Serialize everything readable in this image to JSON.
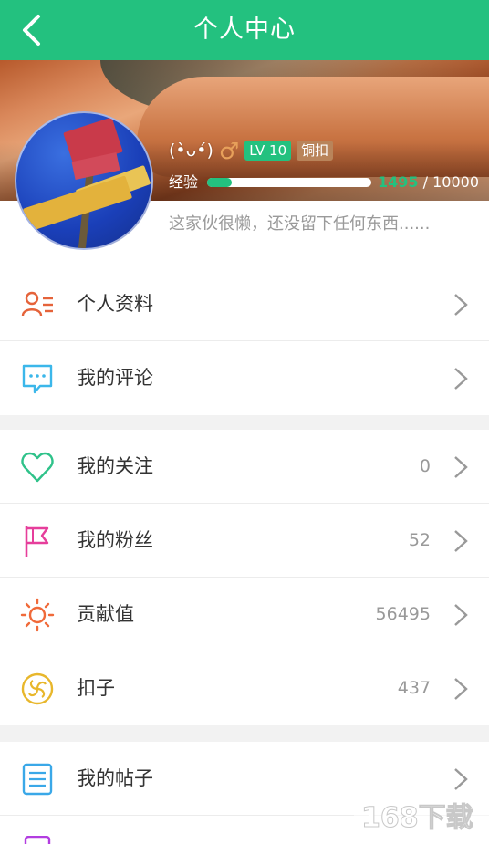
{
  "header": {
    "title": "个人中心"
  },
  "profile": {
    "nickname": "(•̀ᴗ•́)",
    "gender_symbol": "♂",
    "level_badge": "LV 10",
    "level_name": "铜扣",
    "exp_label": "经验",
    "exp_current": "1495",
    "exp_separator": " / ",
    "exp_max": "10000",
    "exp_fraction": 0.1495,
    "signature": "这家伙很懒，还没留下任何东西......"
  },
  "menu": {
    "group1": [
      {
        "label": "个人资料",
        "icon": "profile-icon"
      },
      {
        "label": "我的评论",
        "icon": "comment-icon"
      }
    ],
    "group2": [
      {
        "label": "我的关注",
        "count": "0",
        "icon": "heart-icon"
      },
      {
        "label": "我的粉丝",
        "count": "52",
        "icon": "flag-icon"
      },
      {
        "label": "贡献值",
        "count": "56495",
        "icon": "sun-icon"
      },
      {
        "label": "扣子",
        "count": "437",
        "icon": "button-coin-icon"
      }
    ],
    "group3": [
      {
        "label": "我的帖子",
        "icon": "post-list-icon"
      }
    ]
  },
  "colors": {
    "accent": "#23c17f",
    "profile_icon": "#e5633a",
    "comment_icon": "#3bb7ea",
    "heart_icon": "#2fc28a",
    "flag_icon": "#e63e9b",
    "sun_icon": "#f06a3a",
    "coin_icon": "#e8b72c",
    "post_icon": "#3aa8e8"
  },
  "watermark": {
    "text": "168下载"
  }
}
